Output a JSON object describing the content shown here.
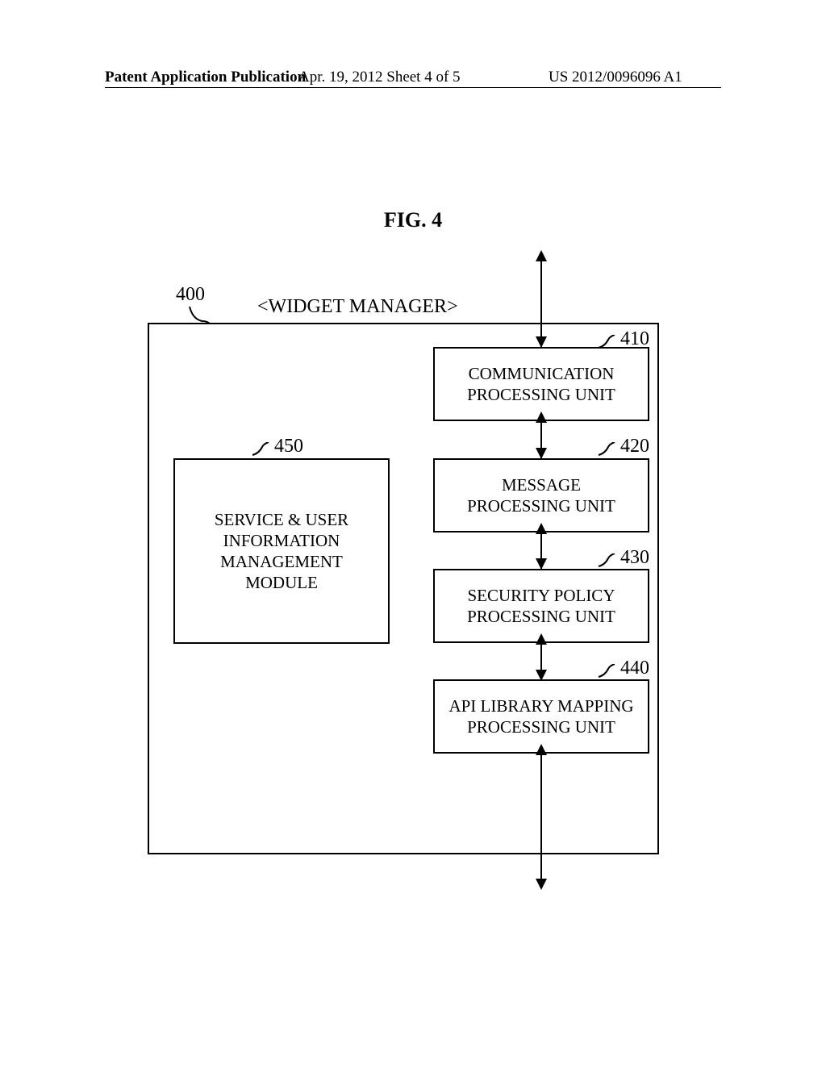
{
  "header": {
    "left": "Patent Application Publication",
    "center": "Apr. 19, 2012  Sheet 4 of 5",
    "right": "US 2012/0096096 A1"
  },
  "figure": {
    "title": "FIG. 4",
    "main_label": "<WIDGET MANAGER>",
    "ref_400": "400",
    "blocks": {
      "b410": {
        "ref": "410",
        "text": "COMMUNICATION\nPROCESSING UNIT"
      },
      "b420": {
        "ref": "420",
        "text": "MESSAGE\nPROCESSING UNIT"
      },
      "b430": {
        "ref": "430",
        "text": "SECURITY POLICY\nPROCESSING UNIT"
      },
      "b440": {
        "ref": "440",
        "text": "API LIBRARY MAPPING\nPROCESSING UNIT"
      },
      "b450": {
        "ref": "450",
        "text": "SERVICE & USER\nINFORMATION\nMANAGEMENT\nMODULE"
      }
    }
  },
  "chart_data": {
    "type": "table",
    "title": "Widget Manager block diagram (FIG. 4)",
    "container": {
      "ref": "400",
      "label": "WIDGET MANAGER"
    },
    "nodes": [
      {
        "ref": "410",
        "label": "COMMUNICATION PROCESSING UNIT"
      },
      {
        "ref": "420",
        "label": "MESSAGE PROCESSING UNIT"
      },
      {
        "ref": "430",
        "label": "SECURITY POLICY PROCESSING UNIT"
      },
      {
        "ref": "440",
        "label": "API LIBRARY MAPPING PROCESSING UNIT"
      },
      {
        "ref": "450",
        "label": "SERVICE & USER INFORMATION MANAGEMENT MODULE"
      }
    ],
    "edges": [
      {
        "from": "external_top",
        "to": "410",
        "bidirectional": true
      },
      {
        "from": "410",
        "to": "420",
        "bidirectional": true
      },
      {
        "from": "420",
        "to": "430",
        "bidirectional": true
      },
      {
        "from": "430",
        "to": "440",
        "bidirectional": true
      },
      {
        "from": "440",
        "to": "external_bottom",
        "bidirectional": true
      }
    ]
  }
}
